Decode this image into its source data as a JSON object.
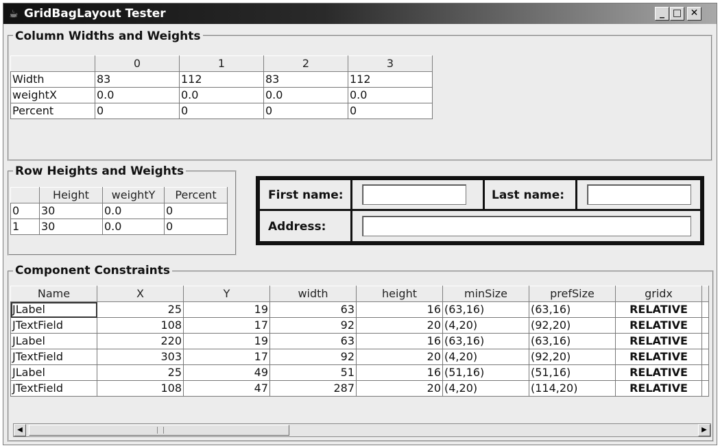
{
  "window": {
    "title": "GridBagLayout Tester",
    "icon": "java-cup-icon",
    "minimize_label": "_",
    "maximize_label": "□",
    "close_label": "✕"
  },
  "columns_panel": {
    "title": "Column Widths and Weights",
    "headers": [
      "",
      "0",
      "1",
      "2",
      "3"
    ],
    "rows": [
      {
        "label": "Width",
        "values": [
          "83",
          "112",
          "83",
          "112"
        ]
      },
      {
        "label": "weightX",
        "values": [
          "0.0",
          "0.0",
          "0.0",
          "0.0"
        ]
      },
      {
        "label": "Percent",
        "values": [
          "0",
          "0",
          "0",
          "0"
        ]
      }
    ]
  },
  "rows_panel": {
    "title": "Row Heights and Weights",
    "headers": [
      "",
      "Height",
      "weightY",
      "Percent"
    ],
    "rows": [
      {
        "label": "0",
        "values": [
          "30",
          "0.0",
          "0"
        ]
      },
      {
        "label": "1",
        "values": [
          "30",
          "0.0",
          "0"
        ]
      }
    ]
  },
  "form_preview": {
    "first_name_label": "First name:",
    "last_name_label": "Last name:",
    "address_label": "Address:"
  },
  "constraints_panel": {
    "title": "Component Constraints",
    "headers": [
      "Name",
      "X",
      "Y",
      "width",
      "height",
      "minSize",
      "prefSize",
      "gridx"
    ],
    "rows": [
      [
        "JLabel",
        "25",
        "19",
        "63",
        "16",
        "(63,16)",
        "(63,16)",
        "RELATIVE"
      ],
      [
        "JTextField",
        "108",
        "17",
        "92",
        "20",
        "(4,20)",
        "(92,20)",
        "RELATIVE"
      ],
      [
        "JLabel",
        "220",
        "19",
        "63",
        "16",
        "(63,16)",
        "(63,16)",
        "RELATIVE"
      ],
      [
        "JTextField",
        "303",
        "17",
        "92",
        "20",
        "(4,20)",
        "(92,20)",
        "RELATIVE"
      ],
      [
        "JLabel",
        "25",
        "49",
        "51",
        "16",
        "(51,16)",
        "(51,16)",
        "RELATIVE"
      ],
      [
        "JTextField",
        "108",
        "47",
        "287",
        "20",
        "(4,20)",
        "(114,20)",
        "RELATIVE"
      ]
    ]
  },
  "scrollbar": {
    "left_arrow": "◀",
    "right_arrow": "▶"
  }
}
